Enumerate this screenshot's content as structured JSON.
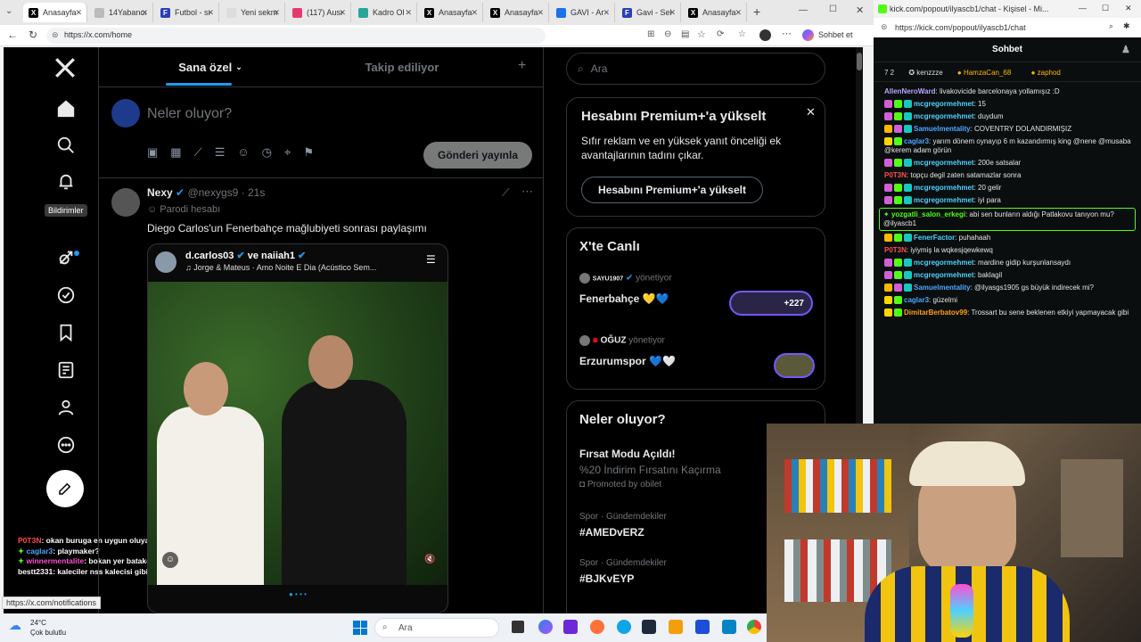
{
  "browser": {
    "tabs": [
      "Anasayfa",
      "14Yabancı",
      "Futbol - sı",
      "Yeni sekm",
      "(117) Ausı",
      "Kadro Ol",
      "Anasayfa",
      "Anasayfa",
      "GAVI - Ar",
      "Gavi - Sel",
      "Anasayfa"
    ],
    "url": "https://x.com/home",
    "status_url": "https://x.com/notifications",
    "copilot_label": "Sohbet et"
  },
  "x": {
    "tabs": {
      "for_you": "Sana özel",
      "following": "Takip ediliyor"
    },
    "nav_tooltip": "Bildirimler",
    "composer": {
      "placeholder": "Neler oluyor?",
      "post_button": "Gönderi yayınla"
    },
    "tweet": {
      "name": "Nexy",
      "handle": "@nexygs9",
      "time": "· 21s",
      "parody": "Parodi hesabı",
      "text": "Diego Carlos'un Fenerbahçe mağlubiyeti sonrası paylaşımı",
      "embed_user": "d.carlos03",
      "embed_and": "ve naiiah1",
      "embed_song": "Jorge & Mateus · Amo Noite E Dia (Acústico Sem..."
    },
    "search_placeholder": "Ara",
    "premium": {
      "title": "Hesabını Premium+'a yükselt",
      "body": "Sıfır reklam ve en yüksek yanıt önceliği ek avantajlarının tadını çıkar.",
      "button": "Hesabını Premium+'a yükselt"
    },
    "live": {
      "title": "X'te Canlı",
      "items": [
        {
          "host": "SAYU1907",
          "role": "yönetiyor",
          "title": "Fenerbahçe 💛💙",
          "count": "+227"
        },
        {
          "host": "OĞUZ",
          "role": "yönetiyor",
          "title": "Erzurumspor 💙🤍",
          "count": ""
        }
      ]
    },
    "trends": {
      "title": "Neler oluyor?",
      "promo_title": "Fırsat Modu Açıldı!",
      "promo_sub": "%20 İndirim Fırsatını Kaçırma",
      "promo_by": "Promoted by obilet",
      "items": [
        {
          "cat": "Spor · Gündemdekiler",
          "tag": "#AMEDvERZ"
        },
        {
          "cat": "Spor · Gündemdekiler",
          "tag": "#BJKvEYP"
        }
      ]
    },
    "overlay_chat": [
      {
        "user": "P0T3N",
        "text": ": okan buruga en uygun oluyan topçu falan",
        "color": "#ff4d4d"
      },
      {
        "user": "caglar3",
        "text": ": playmaker?",
        "color": "#4da6ff"
      },
      {
        "user": "winnermentalite",
        "text": ": bokan yer batakovi",
        "color": "#ff4dd2"
      },
      {
        "user": "bestt2331",
        "text": ": kaleciler nss kalecisi gibi",
        "color": "#ffffff"
      }
    ]
  },
  "chat": {
    "window_url": "kick.com/popout/ilyascb1/chat - Kişisel - Mi...",
    "url": "https://kick.com/popout/ilyascb1/chat",
    "title": "Sohbet",
    "topbar": {
      "count": "7 2",
      "u1": "kenzzze",
      "u2": "HamzaCan_68",
      "u3": "zaphod"
    },
    "messages": [
      {
        "user": "AllenNeroWard",
        "text": ": livakovicide barcelonaya yollamışız :D",
        "color": "#b9a6ff"
      },
      {
        "user": "mcgregormehmet",
        "text": ": 15",
        "color": "#4dd2ff"
      },
      {
        "user": "mcgregormehmet",
        "text": ": duydum",
        "color": "#4dd2ff"
      },
      {
        "user": "Samuelmentality",
        "text": ": COVENTRY DOLANDIRMIŞIZ",
        "color": "#4da6ff"
      },
      {
        "user": "caglar3",
        "text": ": yarım dönem oynayıp 6 m kazandırmış king @nene @musaba @kerem adam görün",
        "color": "#4da6ff"
      },
      {
        "user": "mcgregormehmet",
        "text": ": 200e satsalar",
        "color": "#4dd2ff"
      },
      {
        "user": "P0T3N",
        "text": ": topçu degil zaten satamazlar sonra",
        "color": "#ff4d4d"
      },
      {
        "user": "mcgregormehmet",
        "text": ": 20 gelir",
        "color": "#4dd2ff"
      },
      {
        "user": "mcgregormehmet",
        "text": ": iyi para",
        "color": "#4dd2ff"
      },
      {
        "user": "yozgatli_salon_erkegi",
        "text": ": abi sen bunların aldığı Patlakovu tanıyon mu? @ilyascb1",
        "color": "#53fc18",
        "highlight": true
      },
      {
        "user": "FenerFactor",
        "text": ": puhahaah",
        "color": "#4dd2ff"
      },
      {
        "user": "P0T3N",
        "text": ": iyiymiş la wqkesjqewkewq",
        "color": "#ff4d4d"
      },
      {
        "user": "mcgregormehmet",
        "text": ": mardine gidip kurşunlansaydı",
        "color": "#4dd2ff"
      },
      {
        "user": "mcgregormehmet",
        "text": ": baklagil",
        "color": "#4dd2ff"
      },
      {
        "user": "Samuelmentality",
        "text": ": @ilyasgs1905 gs büyük indirecek mi?",
        "color": "#4da6ff"
      },
      {
        "user": "caglar3",
        "text": ": güzelmi",
        "color": "#4da6ff"
      },
      {
        "user": "DimitarBerbatov99",
        "text": ": Trossart bu sene beklenen etkiyi yapmayacak gibi",
        "color": "#ff9f1a"
      }
    ]
  },
  "taskbar": {
    "weather": "24°C",
    "weather_sub": "Çok bulutlu",
    "search": "Ara"
  }
}
